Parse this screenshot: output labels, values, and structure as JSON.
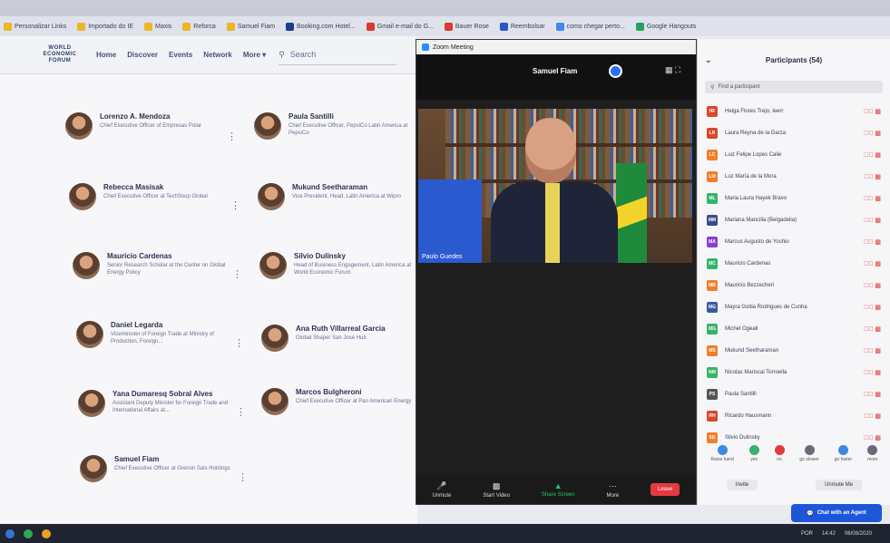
{
  "bookmarks": [
    "Personalizar Links",
    "Importado do IE",
    "Maxis",
    "Reforca",
    "Samuel Fiam",
    "Booking.com Hotel...",
    "Gmail e-mail do G...",
    "Bauer Rose",
    "Reembolsar",
    "como chegar perto...",
    "Google Hangouts"
  ],
  "wef": {
    "logo": "WORLD ECONOMIC FORUM",
    "nav": [
      "Home",
      "Discover",
      "Events",
      "Network",
      "More ▾"
    ],
    "search_placeholder": "Search",
    "people": [
      {
        "name": "Lorenzo A. Mendoza",
        "role": "Chief Executive Officer of Empresas Polar"
      },
      {
        "name": "Paula Santilli",
        "role": "Chief Executive Officer, PepsiCo Latin America at PepsiCo"
      },
      {
        "name": "Rebecca Masisak",
        "role": "Chief Executive Officer at TechSoup Global"
      },
      {
        "name": "Mukund Seetharaman",
        "role": "Vice President, Head, Latin America at Wipro"
      },
      {
        "name": "Mauricio Cardenas",
        "role": "Senior Research Scholar at the Center on Global Energy Policy"
      },
      {
        "name": "Silvio Dulinsky",
        "role": "Head of Business Engagement, Latin America at World Economic Forum"
      },
      {
        "name": "Daniel Legarda",
        "role": "Viceminister of Foreign Trade at Ministry of Production, Foreign..."
      },
      {
        "name": "Ana Ruth Villarreal Garcia",
        "role": "Global Shaper San José Hub"
      },
      {
        "name": "Yana Dumaresq Sobral Alves",
        "role": "Assistant Deputy Minister for Foreign Trade and International Affairs at..."
      },
      {
        "name": "Marcos Bulgheroni",
        "role": "Chief Executive Officer at Pan American Energy"
      },
      {
        "name": "Samuel Fiam",
        "role": "Chief Executive Officer at Grenon Sals Holdings"
      }
    ]
  },
  "zoom": {
    "title": "Zoom Meeting",
    "speaker": "Samuel Fiam",
    "video_label": "Paulo Guedes",
    "toolbar": {
      "unmute": "Unmute",
      "video": "Start Video",
      "share": "Share Screen",
      "more": "More",
      "leave": "Leave"
    }
  },
  "participants": {
    "title": "Participants (54)",
    "find": "Find a participant",
    "list": [
      {
        "initials": "HF",
        "name": "Helga Flores Trejo, leerr",
        "color": "#d9472b"
      },
      {
        "initials": "LR",
        "name": "Laura Reyna de la Garza",
        "color": "#d9472b"
      },
      {
        "initials": "LC",
        "name": "Luiz Felipe Lopes Calie",
        "color": "#f07f2a"
      },
      {
        "initials": "LM",
        "name": "Luz María de la Mora",
        "color": "#f07f2a"
      },
      {
        "initials": "ML",
        "name": "Maria Laura Hayek Bravo",
        "color": "#35b36a"
      },
      {
        "initials": "MM",
        "name": "Mariana Mancilla (Belgadelia)",
        "color": "#3a4a8c"
      },
      {
        "initials": "MA",
        "name": "Marcus Augusto de Yoshio",
        "color": "#8a3fd1"
      },
      {
        "initials": "MC",
        "name": "Mauricio Cardenas",
        "color": "#35b36a"
      },
      {
        "initials": "MB",
        "name": "Mauricio Bezzecheri",
        "color": "#f07f2a"
      },
      {
        "initials": "MG",
        "name": "Mayra Goitia Rodrigues de Cunha",
        "color": "#3a5aa8"
      },
      {
        "initials": "MG",
        "name": "Michel Ogeali",
        "color": "#35b36a"
      },
      {
        "initials": "MS",
        "name": "Mukund Seetharaman",
        "color": "#f07f2a"
      },
      {
        "initials": "NM",
        "name": "Nicolas Mariscal Torroella",
        "color": "#35b36a"
      },
      {
        "initials": "PS",
        "name": "Paula Santilli",
        "color": "#555555"
      },
      {
        "initials": "RH",
        "name": "Ricardo Hausmann",
        "color": "#d9472b"
      },
      {
        "initials": "SD",
        "name": "Silvio Dulinsky",
        "color": "#f07f2a"
      }
    ],
    "reactions": [
      "Raise hand",
      "yes",
      "no",
      "go slower",
      "go faster",
      "more"
    ],
    "buttons": {
      "invite": "Invite",
      "unmute_me": "Unmute Me"
    }
  },
  "chat_button": "Chat with an Agent",
  "taskbar": {
    "lang": "POR",
    "time": "14:42",
    "date": "06/08/2020"
  }
}
